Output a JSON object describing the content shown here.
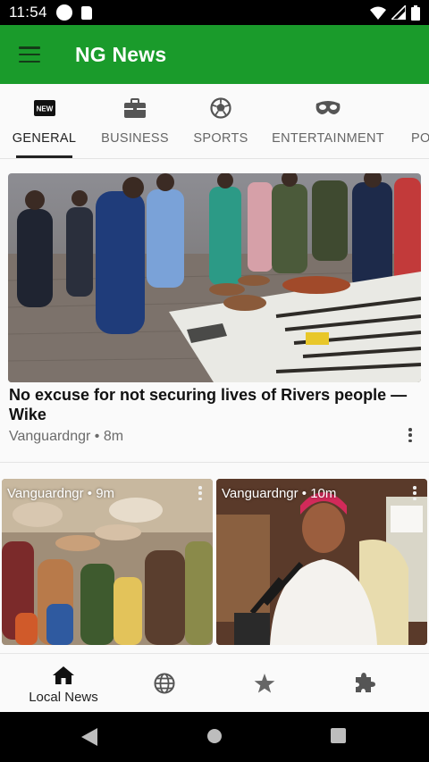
{
  "status_bar": {
    "time": "11:54"
  },
  "app_bar": {
    "title": "NG News",
    "color": "#1a9b2b"
  },
  "tabs": [
    {
      "label": "GENERAL",
      "icon": "new-badge-icon",
      "active": true
    },
    {
      "label": "BUSINESS",
      "icon": "briefcase-icon",
      "active": false
    },
    {
      "label": "SPORTS",
      "icon": "soccer-ball-icon",
      "active": false
    },
    {
      "label": "ENTERTAINMENT",
      "icon": "mask-icon",
      "active": false
    },
    {
      "label": "PO",
      "icon": "",
      "active": false
    }
  ],
  "feed": {
    "hero": {
      "title": "No excuse for not securing lives of Rivers people — Wike",
      "meta": "Vanguardngr • 8m"
    },
    "cards": [
      {
        "meta": "Vanguardngr • 9m"
      },
      {
        "meta": "Vanguardngr • 10m"
      }
    ]
  },
  "bottom_nav": [
    {
      "label": "Local News",
      "icon": "home-icon",
      "active": true
    },
    {
      "label": "",
      "icon": "globe-icon",
      "active": false
    },
    {
      "label": "",
      "icon": "star-icon",
      "active": false
    },
    {
      "label": "",
      "icon": "puzzle-icon",
      "active": false
    }
  ],
  "system_nav": [
    "back-icon",
    "home-circle-icon",
    "recents-icon"
  ]
}
